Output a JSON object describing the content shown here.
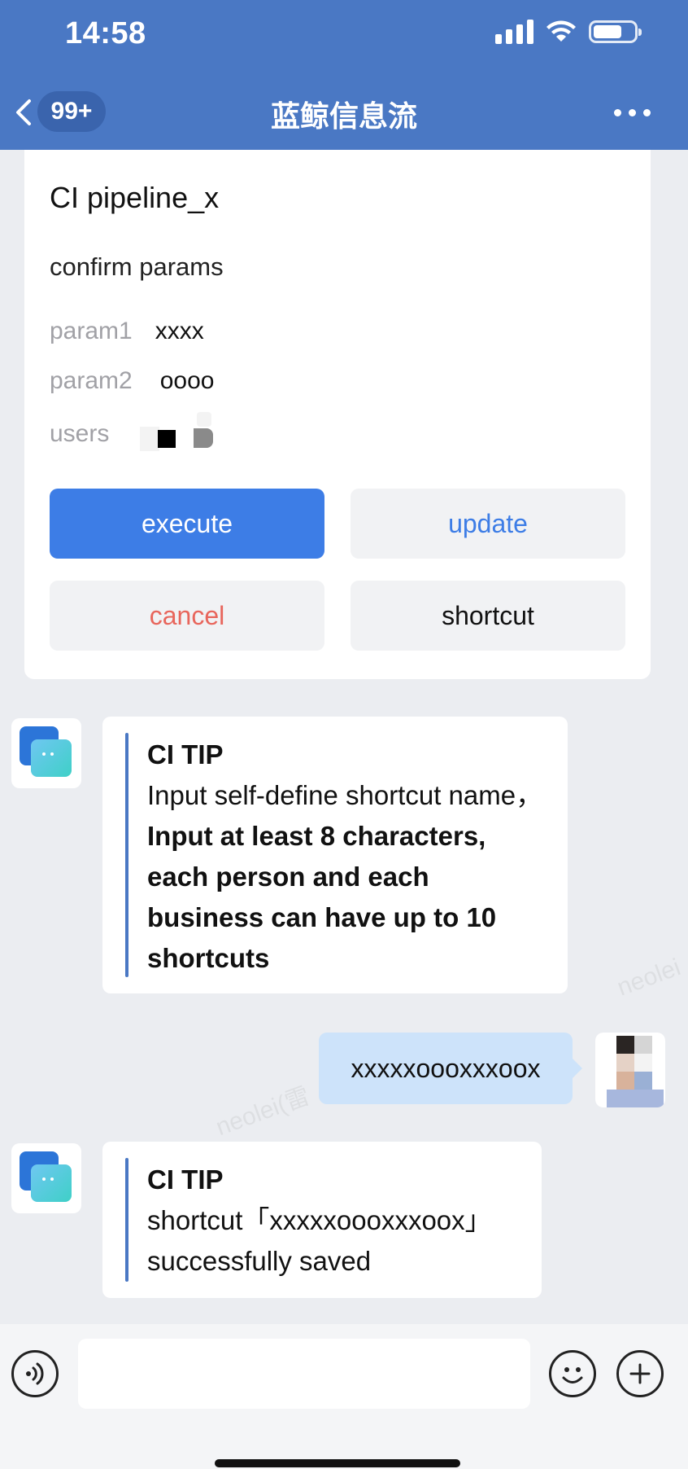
{
  "status_bar": {
    "time": "14:58"
  },
  "nav": {
    "badge": "99+",
    "title": "蓝鲸信息流"
  },
  "card": {
    "title": "CI pipeline_x",
    "subtitle": "confirm params",
    "params": [
      {
        "label": "param1",
        "value": "xxxx"
      },
      {
        "label": "param2",
        "value": "oooo"
      }
    ],
    "users_label": "users",
    "buttons": {
      "execute": "execute",
      "update": "update",
      "cancel": "cancel",
      "shortcut": "shortcut"
    }
  },
  "messages": {
    "tip1": {
      "title": "CI TIP",
      "text_plain": "Input self-define shortcut name，",
      "text_bold": "Input at least 8 characters, each person and each business can have up to 10 shortcuts"
    },
    "user_message": "xxxxxoooxxxoox",
    "tip2": {
      "title": "CI TIP",
      "text": "shortcut「xxxxxoooxxxoox」successfully saved"
    }
  },
  "watermark": {
    "text1": "neolei(雷",
    "text2": "neolei"
  },
  "colors": {
    "header": "#4a78c4",
    "primary_button": "#3d7de6",
    "cancel_text": "#e8665c",
    "user_bubble": "#cde3fa"
  },
  "icons": {
    "back": "chevron-left-icon",
    "more": "more-icon",
    "voice": "voice-icon",
    "emoji": "emoji-icon",
    "plus": "plus-icon"
  }
}
